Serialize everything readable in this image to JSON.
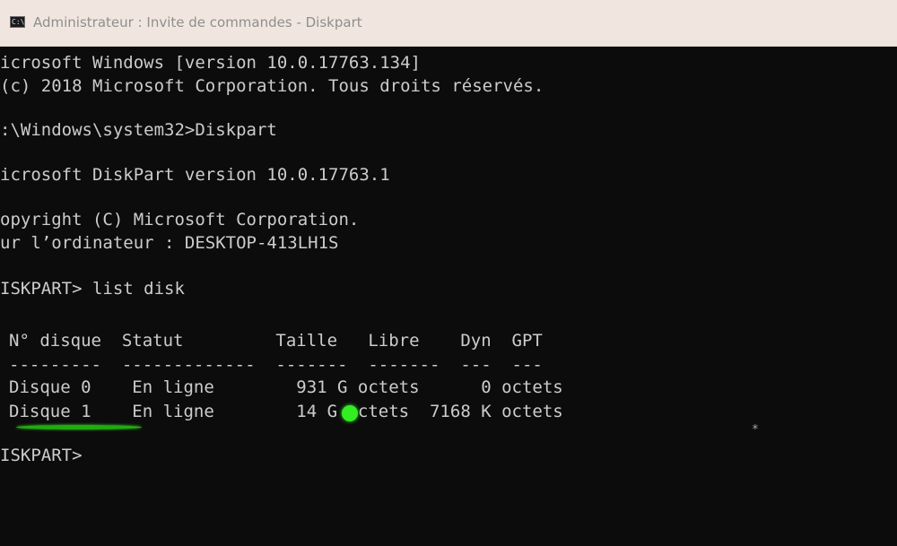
{
  "window": {
    "title": "Administrateur : Invite de commandes - Diskpart",
    "icon": "cmd-icon",
    "icon_glyph": "C:\\"
  },
  "console": {
    "lines": [
      "icrosoft Windows [version 10.0.17763.134]",
      "(c) 2018 Microsoft Corporation. Tous droits réservés.",
      ":\\Windows\\system32>Diskpart",
      "icrosoft DiskPart version 10.0.17763.1",
      "opyright (C) Microsoft Corporation.",
      "ur l’ordinateur : DESKTOP-413LH1S",
      "ISKPART> list disk",
      "N° disque  Statut         Taille   Libre    Dyn  GPT",
      "---------  -------------  -------  -------  ---  ---",
      "Disque 0    En ligne        931 G octets      0 octets",
      "Disque 1    En ligne        14 G octets  7168 K octets",
      "ISKPART>"
    ],
    "gpt_marker": "*"
  },
  "colors": {
    "console_bg": "#0c0c0c",
    "console_text": "#cccccc",
    "titlebar_bg": "#f0e6df",
    "highlight_green": "#33ee22"
  }
}
